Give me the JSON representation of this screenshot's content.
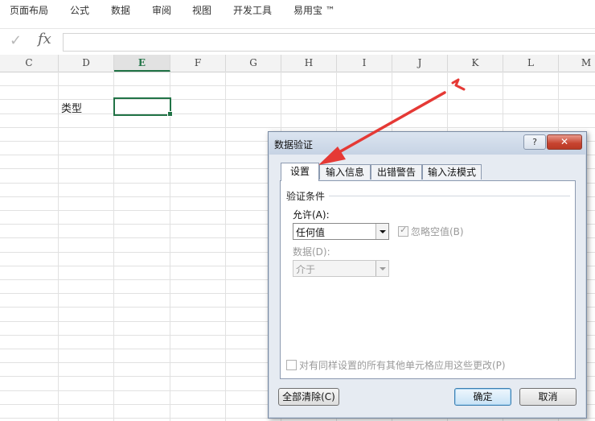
{
  "ribbon": {
    "tabs": [
      "页面布局",
      "公式",
      "数据",
      "审阅",
      "视图",
      "开发工具",
      "易用宝 ™"
    ]
  },
  "formula_bar": {
    "check_glyph": "✓",
    "fx_label": "fx",
    "content": ""
  },
  "grid": {
    "columns": [
      "C",
      "D",
      "E",
      "F",
      "G",
      "H",
      "I",
      "J",
      "K",
      "L",
      "M"
    ],
    "active_column": "E",
    "cells": {
      "D4": "类型",
      "E4": ""
    }
  },
  "dialog": {
    "title": "数据验证",
    "help_label": "?",
    "close_label": "✕",
    "tabs": [
      "设置",
      "输入信息",
      "出错警告",
      "输入法模式"
    ],
    "selected_tab": "设置",
    "group_title": "验证条件",
    "allow_label": "允许(A):",
    "allow_value": "任何值",
    "ignore_blank_label": "忽略空值(B)",
    "ignore_blank_checked": true,
    "data_label": "数据(D):",
    "data_value": "介于",
    "apply_all_label": "对有同样设置的所有其他单元格应用这些更改(P)",
    "apply_all_checked": false,
    "clear_all_label": "全部清除(C)",
    "ok_label": "确定",
    "cancel_label": "取消"
  },
  "annotation": {
    "arrow_color": "#e53935"
  },
  "colors": {
    "excel_green": "#217346"
  }
}
